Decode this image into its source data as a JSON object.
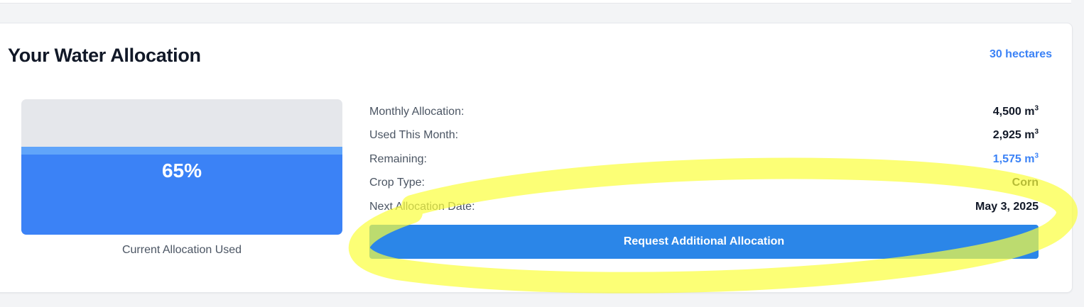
{
  "header": {
    "title": "Your Water Allocation",
    "farm_size": "30 hectares"
  },
  "gauge": {
    "percent_used": 65,
    "percent_label": "65%",
    "caption": "Current Allocation Used"
  },
  "stats": [
    {
      "label": "Monthly Allocation:",
      "value": "4,500 m",
      "unit_sup": "3",
      "accent": false
    },
    {
      "label": "Used This Month:",
      "value": "2,925 m",
      "unit_sup": "3",
      "accent": false
    },
    {
      "label": "Remaining:",
      "value": "1,575 m",
      "unit_sup": "3",
      "accent": true
    },
    {
      "label": "Crop Type:",
      "value": "Corn",
      "unit_sup": "",
      "accent": false
    },
    {
      "label": "Next Allocation Date:",
      "value": "May 3, 2025",
      "unit_sup": "",
      "accent": false
    }
  ],
  "actions": {
    "request_label": "Request Additional Allocation"
  },
  "colors": {
    "accent": "#3b82f6",
    "button": "#2b86e8",
    "gauge_track": "#e5e7eb",
    "highlighter": "#fbff3c"
  }
}
